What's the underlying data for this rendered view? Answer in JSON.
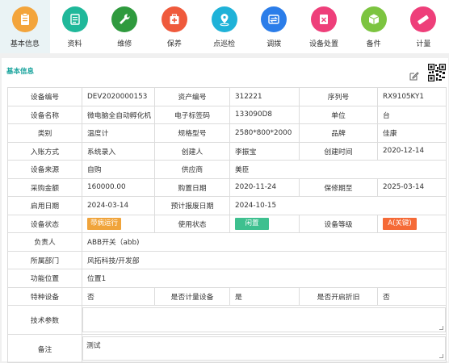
{
  "nav": [
    {
      "label": "基本信息",
      "icon": "clipboard-icon",
      "color": "#f3a43b",
      "active": true
    },
    {
      "label": "资料",
      "icon": "document-icon",
      "color": "#1fb89a"
    },
    {
      "label": "维修",
      "icon": "wrench-icon",
      "color": "#2f9a3e"
    },
    {
      "label": "保养",
      "icon": "medkit-icon",
      "color": "#ef5a3c"
    },
    {
      "label": "点巡检",
      "icon": "location-pin-icon",
      "color": "#1fb2d8"
    },
    {
      "label": "调拨",
      "icon": "transfer-icon",
      "color": "#2b7de9"
    },
    {
      "label": "设备处置",
      "icon": "disposal-icon",
      "color": "#ee3f7a"
    },
    {
      "label": "备件",
      "icon": "box-icon",
      "color": "#7cc440"
    },
    {
      "label": "计量",
      "icon": "ruler-icon",
      "color": "#ee3f7a"
    }
  ],
  "section_title": "基本信息",
  "rows": {
    "r1": {
      "l1": "设备编号",
      "v1": "DEV2020000153",
      "l2": "资产编号",
      "v2": "312221",
      "l3": "序列号",
      "v3": "RX9105KY1"
    },
    "r2": {
      "l1": "设备名称",
      "v1": "微电脑全自动孵化机",
      "l2": "电子标签码",
      "v2": "133090D8",
      "l3": "单位",
      "v3": "台"
    },
    "r3": {
      "l1": "类别",
      "v1": "温度计",
      "l2": "规格型号",
      "v2": "2580*800*2000",
      "l3": "品牌",
      "v3": "佳康"
    },
    "r4": {
      "l1": "入账方式",
      "v1": "系统录入",
      "l2": "创建人",
      "v2": "李振宝",
      "l3": "创建时间",
      "v3": "2020-12-14"
    },
    "r5": {
      "l1": "设备来源",
      "v1": "自购",
      "l2": "供应商",
      "v2": "美臣"
    },
    "r6": {
      "l1": "采购金额",
      "v1": "160000.00",
      "l2": "购置日期",
      "v2": "2020-11-24",
      "l3": "保修期至",
      "v3": "2025-03-14"
    },
    "r7": {
      "l1": "启用日期",
      "v1": "2024-03-14",
      "l2": "预计报废日期",
      "v2": "2024-10-15"
    },
    "r8": {
      "l1": "设备状态",
      "v1": "带病运行",
      "l2": "使用状态",
      "v2": "闲置",
      "l3": "设备等级",
      "v3": "A(关键)"
    },
    "r9": {
      "l1": "负责人",
      "v1": "ABB开关（abb)"
    },
    "r10": {
      "l1": "所属部门",
      "v1": "风拓科技/开发部"
    },
    "r11": {
      "l1": "功能位置",
      "v1": "位置1"
    },
    "r12": {
      "l1": "特种设备",
      "v1": "否",
      "l2": "是否计量设备",
      "v2": "是",
      "l3": "是否开启折旧",
      "v3": "否"
    },
    "r13": {
      "l1": "技术参数",
      "v1": ""
    },
    "r14": {
      "l1": "备注",
      "v1": "测试"
    }
  }
}
